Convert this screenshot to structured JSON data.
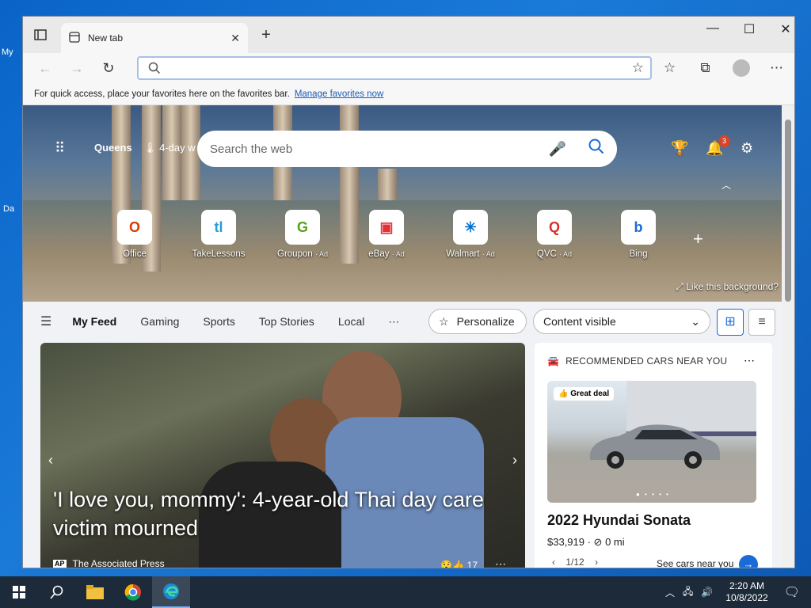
{
  "desktop": {
    "label1": "My",
    "label2": "Da"
  },
  "tab": {
    "title": "New tab"
  },
  "address": {
    "placeholder": ""
  },
  "favbar": {
    "text": "For quick access, place your favorites here on the favorites bar.",
    "link": "Manage favorites now"
  },
  "hero": {
    "location": "Queens",
    "weather": "4-day w",
    "search_placeholder": "Search the web",
    "notification_count": "3",
    "like_bg": "Like this background?"
  },
  "tiles": [
    {
      "label": "Office",
      "ad": "",
      "icon": "O",
      "color": "#d83b01"
    },
    {
      "label": "TakeLessons",
      "ad": "",
      "icon": "tl",
      "color": "#2a9ad8"
    },
    {
      "label": "Groupon",
      "ad": "· Ad",
      "icon": "G",
      "color": "#53a318"
    },
    {
      "label": "eBay",
      "ad": "· Ad",
      "icon": "▣",
      "color": "#e53238"
    },
    {
      "label": "Walmart",
      "ad": "· Ad",
      "icon": "✳",
      "color": "#0071ce"
    },
    {
      "label": "QVC",
      "ad": "· Ad",
      "icon": "Q",
      "color": "#d8302a"
    },
    {
      "label": "Bing",
      "ad": "",
      "icon": "b",
      "color": "#1a6ad8"
    }
  ],
  "feednav": {
    "items": [
      "My Feed",
      "Gaming",
      "Sports",
      "Top Stories",
      "Local"
    ],
    "personalize": "Personalize",
    "content": "Content visible"
  },
  "story": {
    "title": "'I love you, mommy': 4-year-old Thai day care victim mourned",
    "source_logo": "AP",
    "source": "The Associated Press",
    "reactions": "17"
  },
  "car_card": {
    "header": "RECOMMENDED CARS NEAR YOU",
    "deal": "Great deal",
    "model": "2022 Hyundai Sonata",
    "price": "$33,919 · ",
    "mileage": "0 mi",
    "pager": "1/12",
    "see_cars": "See cars near you"
  },
  "clock": {
    "time": "2:20 AM",
    "date": "10/8/2022"
  }
}
